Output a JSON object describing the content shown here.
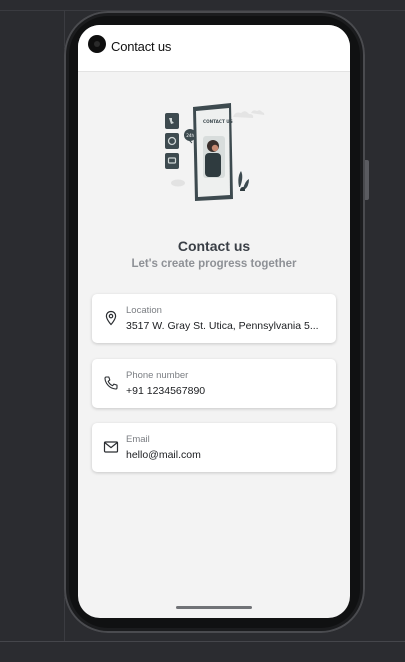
{
  "app_bar": {
    "title": "Contact us"
  },
  "hero": {
    "heading": "Contact us",
    "subheading": "Let's create progress together",
    "illustration_text": "CONTACT US",
    "illustration_badge": "24h"
  },
  "contacts": [
    {
      "icon": "location-pin-icon",
      "label": "Location",
      "value": "3517 W. Gray St. Utica, Pennsylvania 5..."
    },
    {
      "icon": "phone-icon",
      "label": "Phone number",
      "value": "+91 1234567890"
    },
    {
      "icon": "mail-icon",
      "label": "Email",
      "value": "hello@mail.com"
    }
  ],
  "colors": {
    "background": "#2b2c30",
    "screen": "#f3f3f3",
    "card": "#ffffff",
    "heading": "#3a3f46",
    "subheading": "#8e9196",
    "accent_dark": "#3d4a4f"
  }
}
